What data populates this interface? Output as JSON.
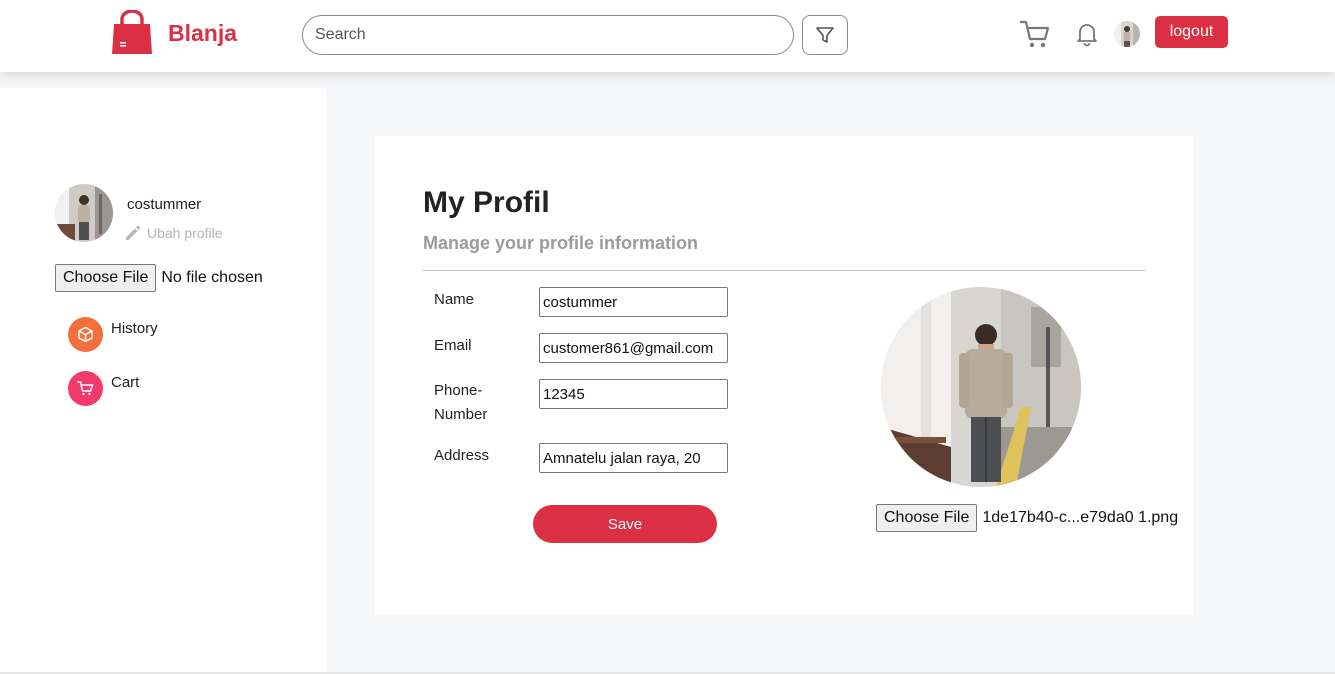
{
  "header": {
    "brand": "Blanja",
    "search_placeholder": "Search",
    "logout_label": "logout",
    "brand_color": "#db3043"
  },
  "sidebar": {
    "username": "costummer",
    "edit_profile_label": "Ubah profile",
    "file_button_label": "Choose File",
    "file_status": "No file chosen",
    "menu": [
      {
        "label": "History",
        "icon": "box-icon",
        "color": "#f36f3e"
      },
      {
        "label": "Cart",
        "icon": "cart-icon",
        "color": "#f23b6b"
      }
    ]
  },
  "profile": {
    "title": "My Profil",
    "subtitle": "Manage your profile information",
    "fields": [
      {
        "label": "Name",
        "value": "costummer"
      },
      {
        "label": "Email",
        "value": "customer861@gmail.com"
      },
      {
        "label": "Phone-Number",
        "value": "12345"
      },
      {
        "label": "Address",
        "value": "Amnatelu jalan raya, 20"
      }
    ],
    "save_label": "Save",
    "file_button_label": "Choose File",
    "file_name": "1de17b40-c...e79da0 1.png"
  }
}
